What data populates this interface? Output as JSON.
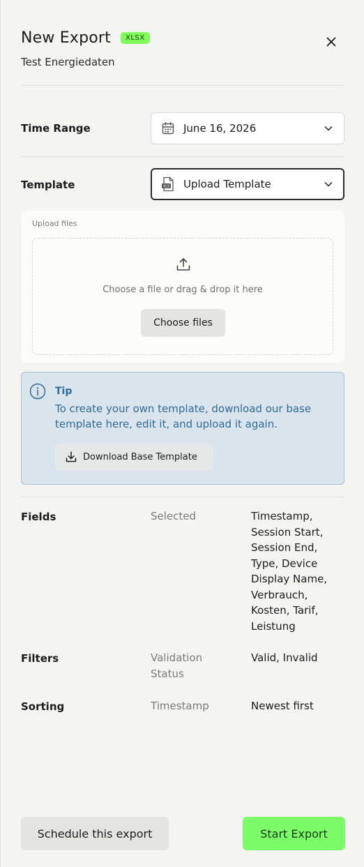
{
  "header": {
    "title": "New Export",
    "badge": "XLSX",
    "subtitle": "Test Energiedaten"
  },
  "time_range": {
    "label": "Time Range",
    "value": "June 16, 2026"
  },
  "template": {
    "label": "Template",
    "value": "Upload Template"
  },
  "upload": {
    "label": "Upload files",
    "prompt": "Choose a file or drag & drop it here",
    "button": "Choose files"
  },
  "tip": {
    "title": "Tip",
    "text": "To create your own template, download our base template here, edit it, and upload it again.",
    "button": "Download Base Template"
  },
  "summary": {
    "fields": {
      "label": "Fields",
      "key": "Selected",
      "value": [
        "Timestamp,",
        "Session Start,",
        "Session End,",
        "Type, Device",
        "Display Name,",
        "Verbrauch,",
        "Kosten, Tarif,",
        "Leistung"
      ]
    },
    "filters": {
      "label": "Filters",
      "key": [
        "Validation",
        "Status"
      ],
      "value": "Valid, Invalid"
    },
    "sorting": {
      "label": "Sorting",
      "key": "Timestamp",
      "value": "Newest first"
    }
  },
  "footer": {
    "schedule": "Schedule this export",
    "start": "Start Export"
  },
  "icons": {
    "close": "close-icon",
    "calendar": "calendar-icon",
    "chevron": "chevron-down-icon",
    "file": "xls-file-icon",
    "upload": "upload-icon",
    "info": "info-icon",
    "download": "download-icon"
  },
  "colors": {
    "accent": "#7dfc6a",
    "tip_bg": "#d9e4ec",
    "tip_text": "#2e6a98"
  }
}
